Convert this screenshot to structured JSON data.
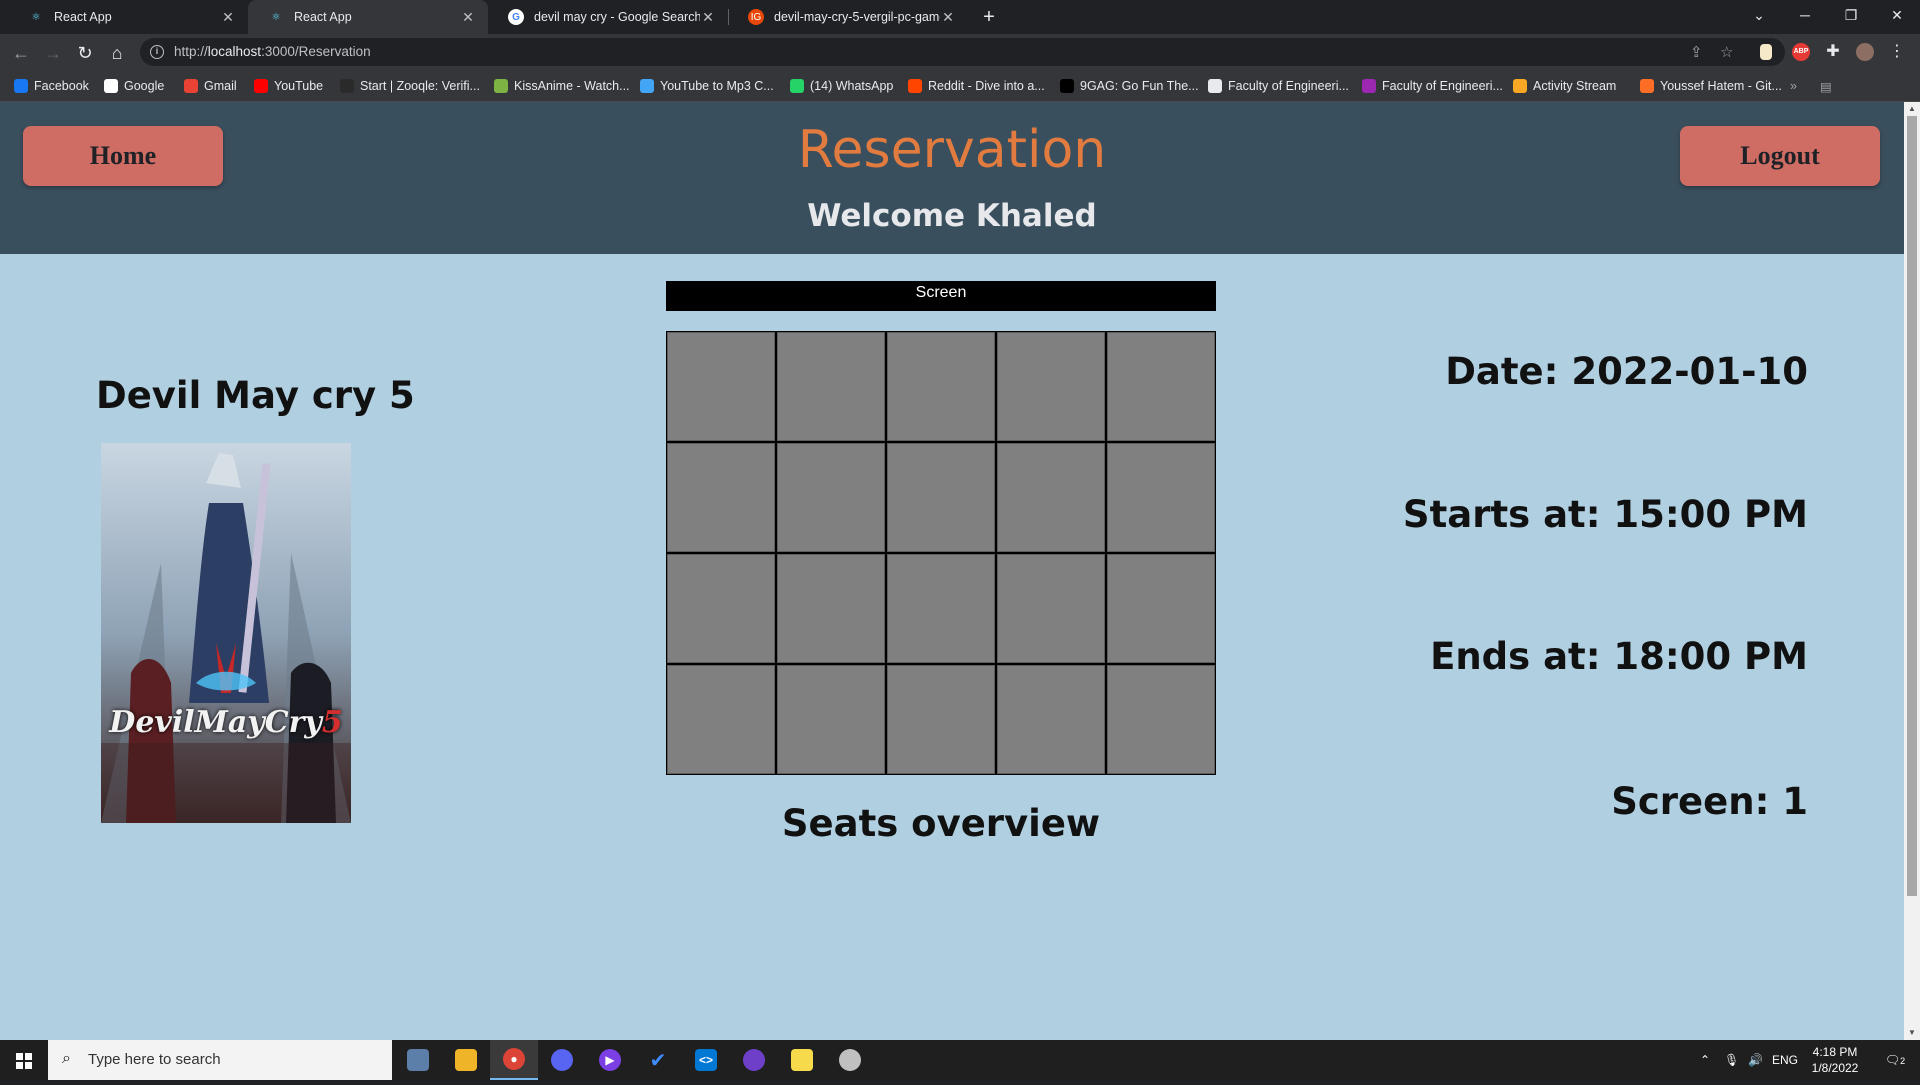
{
  "browser": {
    "tabs": [
      {
        "title": "React App",
        "active": false
      },
      {
        "title": "React App",
        "active": true
      },
      {
        "title": "devil may cry - Google Search",
        "active": false
      },
      {
        "title": "devil-may-cry-5-vergil-pc-game-",
        "active": false
      }
    ],
    "url_prefix": "http://",
    "url_host": "localhost",
    "url_path": ":3000/Reservation",
    "bookmarks": [
      {
        "label": "Facebook",
        "icon": "facebook-icon",
        "color": "#1877f2"
      },
      {
        "label": "Google",
        "icon": "google-icon",
        "color": "#ffffff"
      },
      {
        "label": "Gmail",
        "icon": "gmail-icon",
        "color": "#ea4335"
      },
      {
        "label": "YouTube",
        "icon": "youtube-icon",
        "color": "#ff0000"
      },
      {
        "label": "Start | Zooqle: Verifi...",
        "icon": "zooqle-icon",
        "color": "#2a2a2a"
      },
      {
        "label": "KissAnime - Watch...",
        "icon": "kissanime-icon",
        "color": "#7cb342"
      },
      {
        "label": "YouTube to Mp3 C...",
        "icon": "mp3-icon",
        "color": "#42a5f5"
      },
      {
        "label": "(14) WhatsApp",
        "icon": "whatsapp-icon",
        "color": "#25d366"
      },
      {
        "label": "Reddit - Dive into a...",
        "icon": "reddit-icon",
        "color": "#ff4500"
      },
      {
        "label": "9GAG: Go Fun The...",
        "icon": "9gag-icon",
        "color": "#000000"
      },
      {
        "label": "Faculty of Engineeri...",
        "icon": "faculty-icon",
        "color": "#e8eaed"
      },
      {
        "label": "Faculty of Engineeri...",
        "icon": "faculty-pen-icon",
        "color": "#9c27b0"
      },
      {
        "label": "Activity Stream",
        "icon": "activity-icon",
        "color": "#f9a825"
      },
      {
        "label": "Youssef Hatem - Git...",
        "icon": "gitlab-icon",
        "color": "#fc6d26"
      }
    ]
  },
  "header": {
    "home_label": "Home",
    "title": "Reservation",
    "welcome": "Welcome Khaled",
    "logout_label": "Logout"
  },
  "movie": {
    "title": "Devil May cry 5",
    "poster_text": "DevilMayCry",
    "poster_number": "5"
  },
  "seating": {
    "screen_label": "Screen",
    "rows": 4,
    "columns": 5,
    "overview_label": "Seats overview"
  },
  "details": {
    "date": "Date: 2022-01-10",
    "starts": "Starts at: 15:00 PM",
    "ends": "Ends at: 18:00 PM",
    "screen": "Screen: 1"
  },
  "taskbar": {
    "search_placeholder": "Type here to search",
    "language": "ENG",
    "time": "4:18 PM",
    "date": "1/8/2022",
    "notifications": "2"
  },
  "colors": {
    "page_bg": "#b0d0e2",
    "header_bg": "#3a4f5d",
    "button_bg": "#cf6c63",
    "title": "#e17b3f",
    "seat": "#808080"
  }
}
